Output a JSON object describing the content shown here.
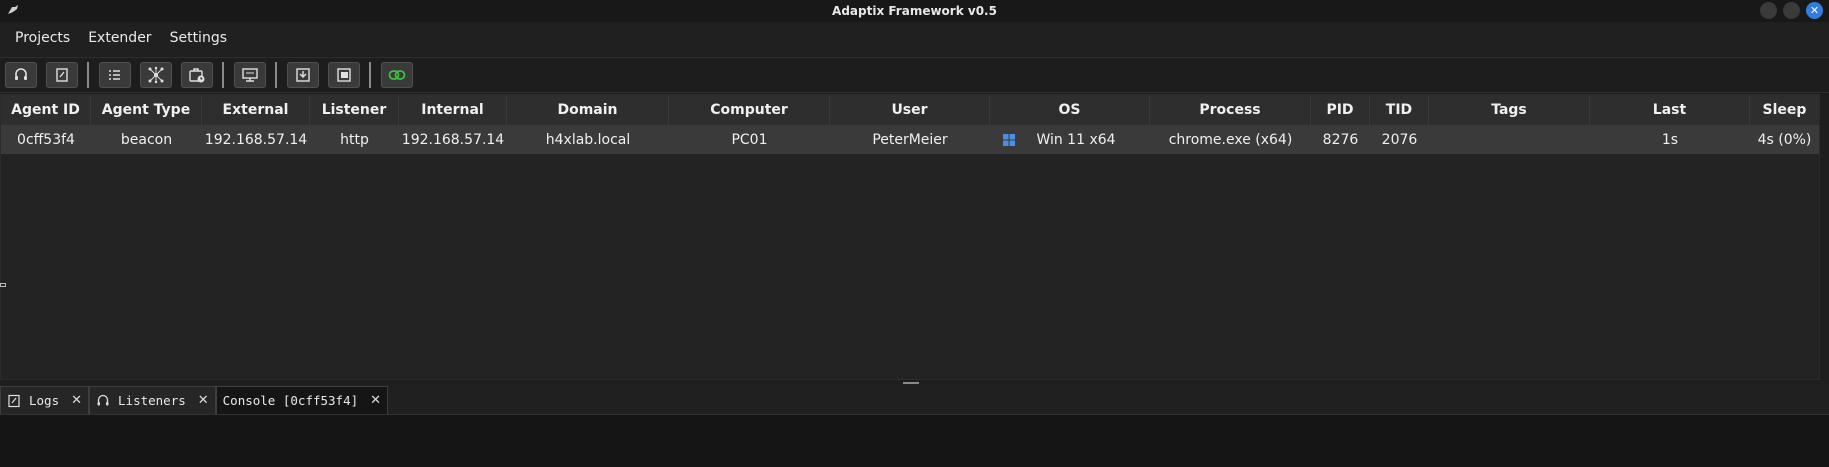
{
  "window": {
    "title": "Adaptix Framework v0.5"
  },
  "menu": {
    "items": [
      "Projects",
      "Extender",
      "Settings"
    ]
  },
  "toolbar": {
    "buttons": [
      "headset-icon",
      "notes-icon",
      "list-icon",
      "graph-icon",
      "tasks-icon",
      "monitor-icon",
      "download-icon",
      "screenshot-icon",
      "link-icon"
    ],
    "accent": "#3fbf3f"
  },
  "table": {
    "headers": [
      "Agent ID",
      "Agent Type",
      "External",
      "Listener",
      "Internal",
      "Domain",
      "Computer",
      "User",
      "OS",
      "Process",
      "PID",
      "TID",
      "Tags",
      "Last",
      "Sleep"
    ],
    "rows": [
      {
        "agent_id": "0cff53f4",
        "agent_type": "beacon",
        "external": "192.168.57.14",
        "listener": "http",
        "internal": "192.168.57.14",
        "domain": "h4xlab.local",
        "computer": "PC01",
        "user": "PeterMeier",
        "os_icon": "windows-icon",
        "os": "Win 11 x64",
        "process": "chrome.exe (x64)",
        "pid": "8276",
        "tid": "2076",
        "tags": "",
        "last": "1s",
        "sleep": "4s (0%)"
      }
    ]
  },
  "tabs": [
    {
      "label": "Logs",
      "icon": "notes-icon"
    },
    {
      "label": "Listeners",
      "icon": "headset-icon"
    },
    {
      "label": "Console [0cff53f4]",
      "icon": ""
    }
  ],
  "colors": {
    "close_button": "#2f7de1",
    "windows_icon": "#4a90e2"
  }
}
